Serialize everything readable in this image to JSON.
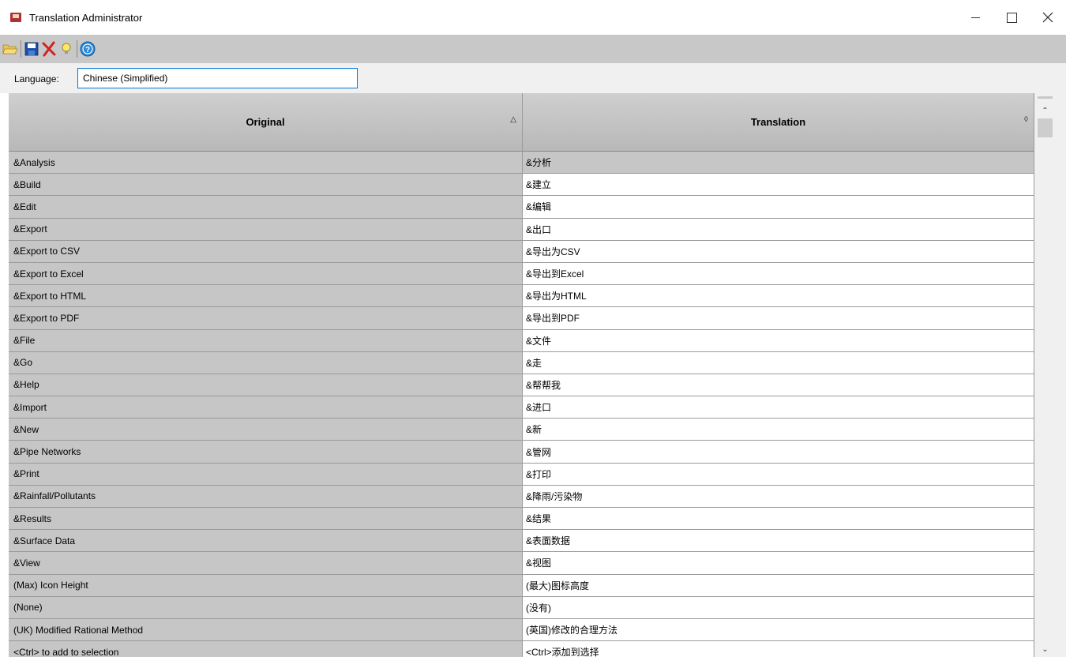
{
  "window": {
    "title": "Translation Administrator",
    "app_icon": "book-icon"
  },
  "toolbar": {
    "buttons": [
      {
        "name": "open",
        "icon": "folder-open-icon"
      },
      {
        "name": "save",
        "icon": "floppy-save-icon"
      },
      {
        "name": "delete",
        "icon": "red-x-delete-icon"
      },
      {
        "name": "hint",
        "icon": "lightbulb-icon"
      },
      {
        "name": "help",
        "icon": "help-circle-icon"
      }
    ]
  },
  "language": {
    "label": "Language:",
    "value": "Chinese (Simplified)"
  },
  "grid": {
    "columns": [
      {
        "label": "Original",
        "sort": "ascending"
      },
      {
        "label": "Translation",
        "sort": "none"
      }
    ],
    "selected_row": 0,
    "rows": [
      {
        "original": "&Analysis",
        "translation": "&分析"
      },
      {
        "original": "&Build",
        "translation": "&建立"
      },
      {
        "original": "&Edit",
        "translation": "&编辑"
      },
      {
        "original": "&Export",
        "translation": "&出口"
      },
      {
        "original": "&Export to CSV",
        "translation": "&导出为CSV"
      },
      {
        "original": "&Export to Excel",
        "translation": "&导出到Excel"
      },
      {
        "original": "&Export to HTML",
        "translation": "&导出为HTML"
      },
      {
        "original": "&Export to PDF",
        "translation": "&导出到PDF"
      },
      {
        "original": "&File",
        "translation": "&文件"
      },
      {
        "original": "&Go",
        "translation": "&走"
      },
      {
        "original": "&Help",
        "translation": "&帮帮我"
      },
      {
        "original": "&Import",
        "translation": "&进口"
      },
      {
        "original": "&New",
        "translation": "&新"
      },
      {
        "original": "&Pipe Networks",
        "translation": "&管网"
      },
      {
        "original": "&Print",
        "translation": "&打印"
      },
      {
        "original": "&Rainfall/Pollutants",
        "translation": "&降雨/污染物"
      },
      {
        "original": "&Results",
        "translation": "&结果"
      },
      {
        "original": "&Surface Data",
        "translation": "&表面数据"
      },
      {
        "original": "&View",
        "translation": "&视图"
      },
      {
        "original": "(Max) Icon Height",
        "translation": "(最大)图标高度"
      },
      {
        "original": "(None)",
        "translation": "(没有)"
      },
      {
        "original": "(UK) Modified Rational Method",
        "translation": "(英国)修改的合理方法"
      },
      {
        "original": "<Ctrl> to add to selection",
        "translation": "<Ctrl>添加到选择"
      }
    ]
  },
  "colors": {
    "toolbar_bg": "#c8c8c8",
    "original_cell_bg": "#c6c6c6",
    "input_border": "#0078d7"
  }
}
